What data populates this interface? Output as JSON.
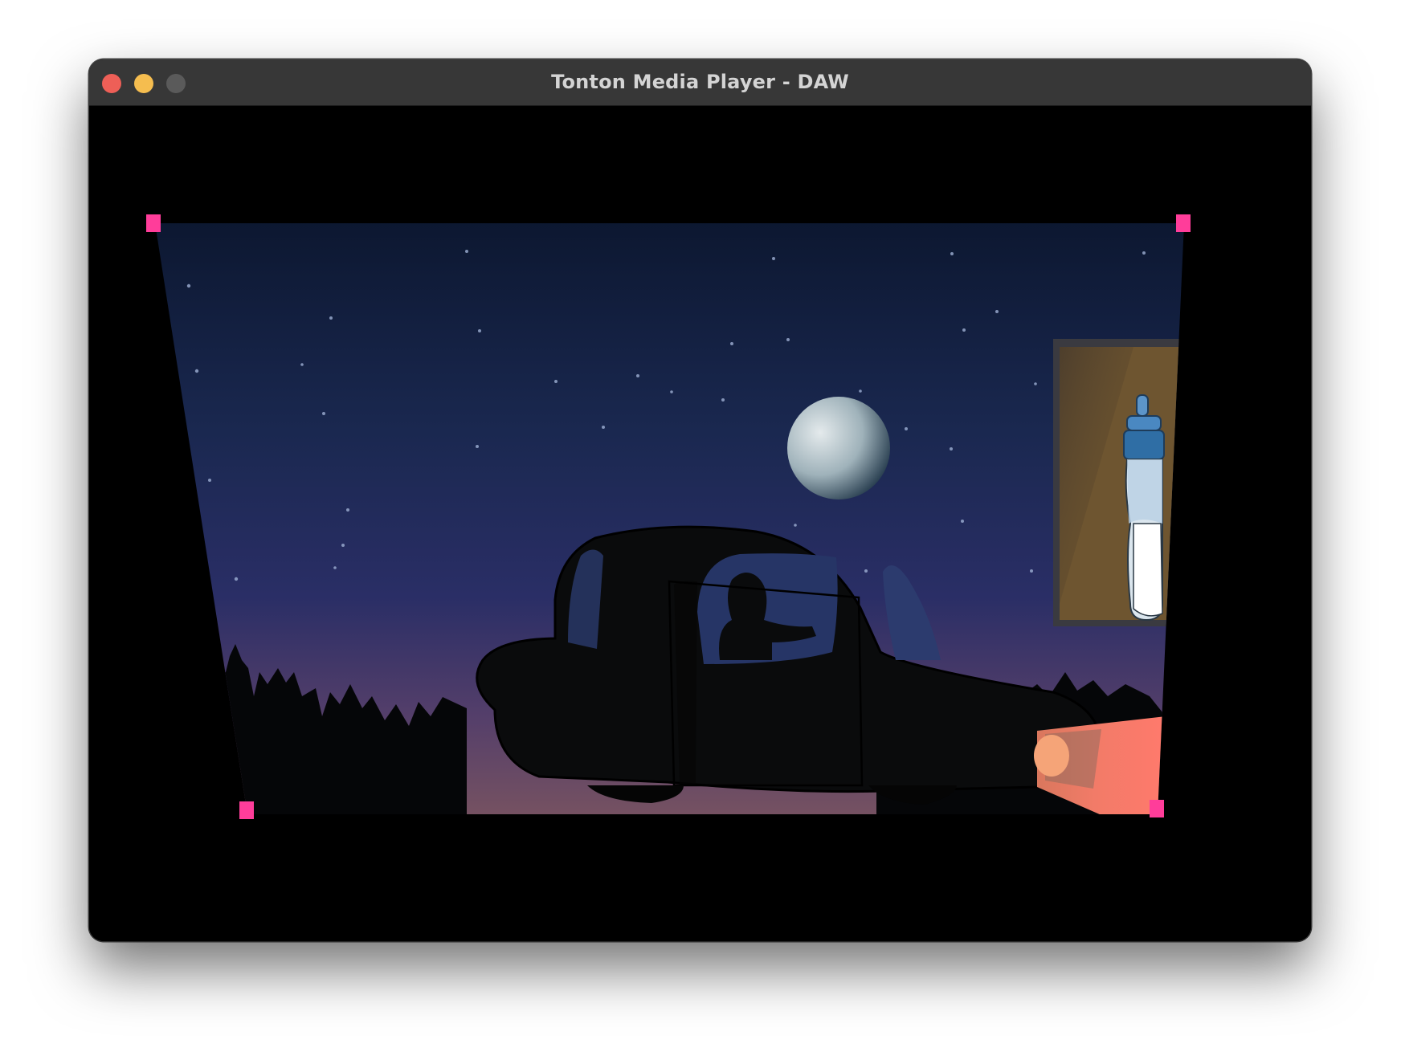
{
  "window": {
    "title": "Tonton Media Player - DAW"
  },
  "traffic_lights": {
    "close_color": "#ee5f57",
    "minimize_color": "#f5bd4f",
    "zoom_color": "#5a5a5a"
  },
  "warp": {
    "handle_color": "#ff3d9a"
  },
  "icons": [
    "close-icon",
    "minimize-icon",
    "zoom-icon",
    "warp-handle-icon"
  ]
}
